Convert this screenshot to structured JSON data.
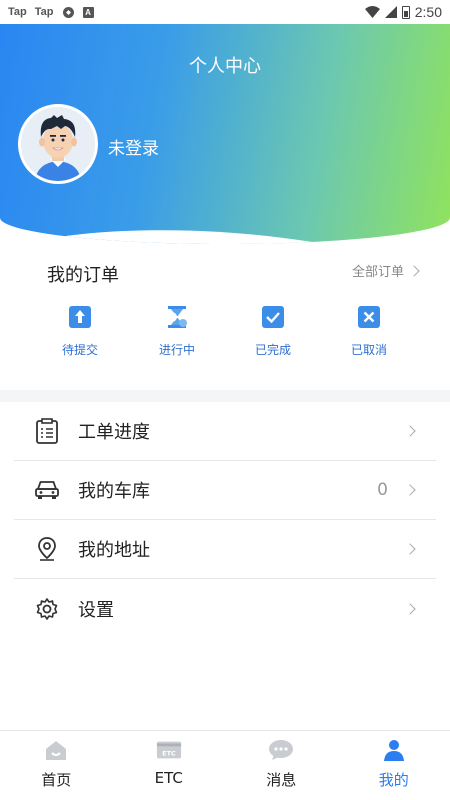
{
  "status_bar": {
    "left_apps": [
      "Tap",
      "Tap"
    ],
    "time": "2:50"
  },
  "header": {
    "title": "个人中心",
    "login_label": "未登录"
  },
  "orders": {
    "title": "我的订单",
    "all_label": "全部订单",
    "items": [
      {
        "label": "待提交",
        "icon": "upload-icon"
      },
      {
        "label": "进行中",
        "icon": "hourglass-icon"
      },
      {
        "label": "已完成",
        "icon": "check-icon"
      },
      {
        "label": "已取消",
        "icon": "cancel-icon"
      }
    ]
  },
  "menu": [
    {
      "label": "工单进度",
      "icon": "clipboard-icon",
      "count": ""
    },
    {
      "label": "我的车库",
      "icon": "car-icon",
      "count": "0"
    },
    {
      "label": "我的地址",
      "icon": "location-pin-icon",
      "count": ""
    },
    {
      "label": "设置",
      "icon": "gear-icon",
      "count": ""
    }
  ],
  "bottom_nav": [
    {
      "label": "首页",
      "icon": "home-icon",
      "active": false
    },
    {
      "label": "ETC",
      "icon": "etc-card-icon",
      "active": false
    },
    {
      "label": "消息",
      "icon": "message-icon",
      "active": false
    },
    {
      "label": "我的",
      "icon": "profile-icon",
      "active": true
    }
  ],
  "colors": {
    "accent": "#2a7ef0",
    "gradient_start": "#2a86f2",
    "gradient_end": "#90e35c",
    "order_label": "#2f6fcf"
  }
}
